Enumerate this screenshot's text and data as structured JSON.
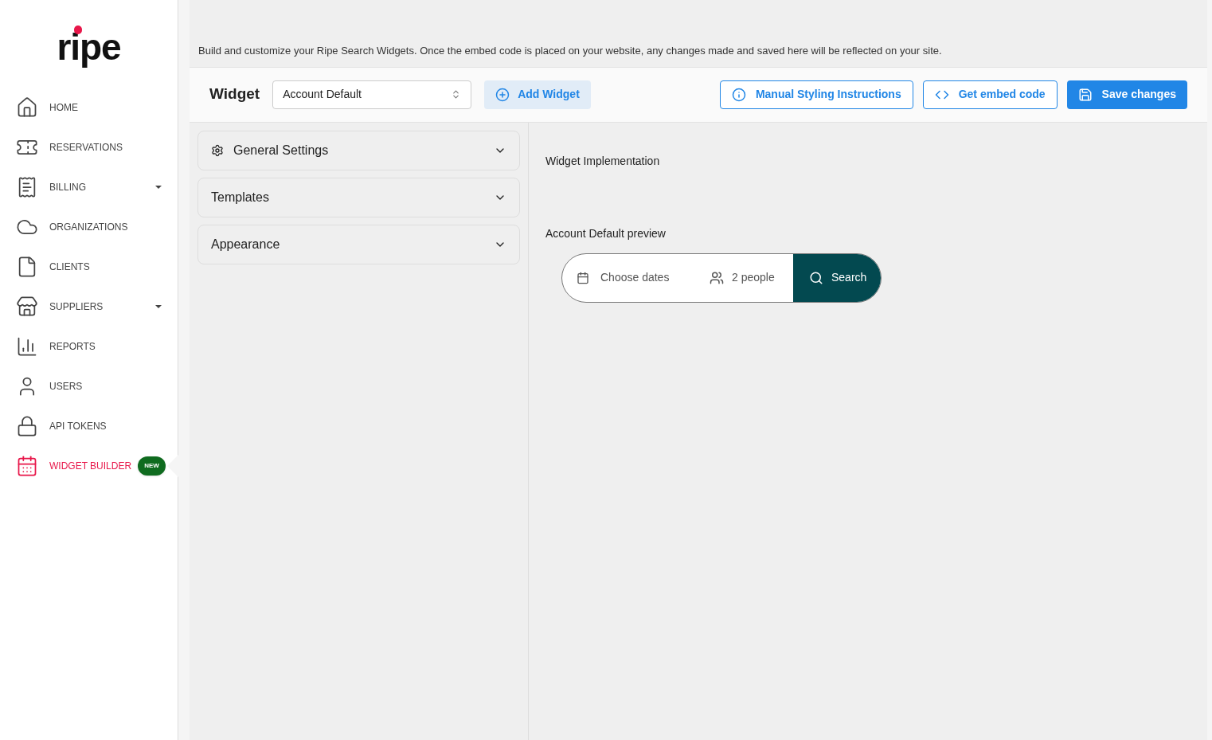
{
  "logo": "ripe",
  "nav": [
    {
      "label": "HOME",
      "has_menu": false,
      "selected": false
    },
    {
      "label": "RESERVATIONS",
      "has_menu": false,
      "selected": false
    },
    {
      "label": "BILLING",
      "has_menu": true,
      "selected": false
    },
    {
      "label": "ORGANIZATIONS",
      "has_menu": false,
      "selected": false
    },
    {
      "label": "CLIENTS",
      "has_menu": false,
      "selected": false
    },
    {
      "label": "SUPPLIERS",
      "has_menu": true,
      "selected": false
    },
    {
      "label": "REPORTS",
      "has_menu": false,
      "selected": false
    },
    {
      "label": "USERS",
      "has_menu": false,
      "selected": false
    },
    {
      "label": "API TOKENS",
      "has_menu": false,
      "selected": false
    },
    {
      "label": "WIDGET BUILDER",
      "has_menu": false,
      "selected": true,
      "badge": "NEW"
    }
  ],
  "intro": "Build and customize your Ripe Search Widgets. Once the embed code is placed on your website, any changes made and saved here will be reflected on your site.",
  "toolbar": {
    "title": "Widget",
    "select_value": "Account Default",
    "add_button": "Add Widget",
    "buttons": [
      {
        "label": "Manual Styling Instructions",
        "kind": "info"
      },
      {
        "label": "Get embed code",
        "kind": "code"
      },
      {
        "label": "Save changes",
        "kind": "save"
      }
    ]
  },
  "sections": [
    {
      "label": "General Settings",
      "kind": "settings",
      "expanded": false
    },
    {
      "label": "Templates",
      "kind": "plain",
      "expanded": false
    },
    {
      "label": "Appearance",
      "kind": "plain",
      "expanded": false
    }
  ],
  "implementation_title": "Widget Implementation",
  "preview": {
    "title": "Account Default preview",
    "dates": "Choose dates",
    "people": "2 people",
    "search": "Search"
  }
}
